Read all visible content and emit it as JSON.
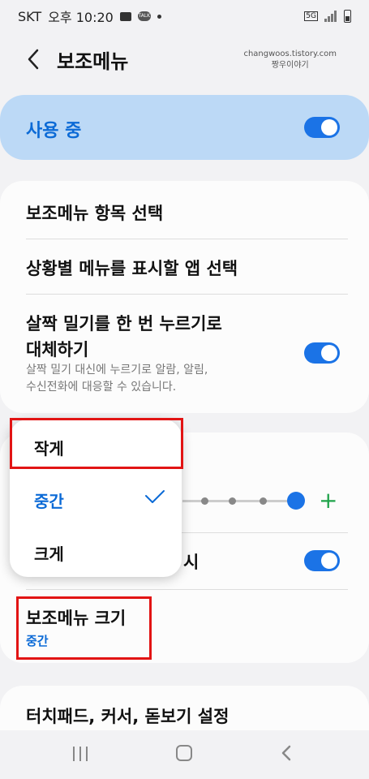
{
  "status_bar": {
    "carrier": "SKT",
    "time": "오후 10:20",
    "icons": [
      "message-icon",
      "kakaotalk-icon",
      "dot-icon",
      "5g-network-icon",
      "signal-icon",
      "battery-icon"
    ],
    "network_label": "5G"
  },
  "header": {
    "title": "보조메뉴",
    "watermark_line1": "changwoos.tistory.com",
    "watermark_line2": "짱우이야기"
  },
  "active_card": {
    "label": "사용 중",
    "toggle_on": true
  },
  "settings": {
    "select_items": "보조메뉴 항목 선택",
    "select_apps": "상황별 메뉴를 표시할 앱 선택",
    "swipe_title_line1": "살짝 밀기를 한 번 누르기로",
    "swipe_title_line2": "대체하기",
    "swipe_sub_line1": "살짝 밀기 대신에 누르기로 알람, 알림,",
    "swipe_sub_line2": "수신전화에 대응할 수 있습니다.",
    "swipe_toggle_on": true,
    "show_row_partial": "시",
    "show_toggle_on": true,
    "size_title": "보조메뉴 크기",
    "size_value": "중간",
    "touchpad_title": "터치패드, 커서, 돋보기 설정"
  },
  "size_popup": {
    "options": [
      "작게",
      "중간",
      "크게"
    ],
    "selected": "중간"
  },
  "colors": {
    "accent": "#0b6ad6",
    "highlight_red": "#e21414",
    "active_card_bg": "#bcd9f6",
    "plus_green": "#1fa34a"
  }
}
